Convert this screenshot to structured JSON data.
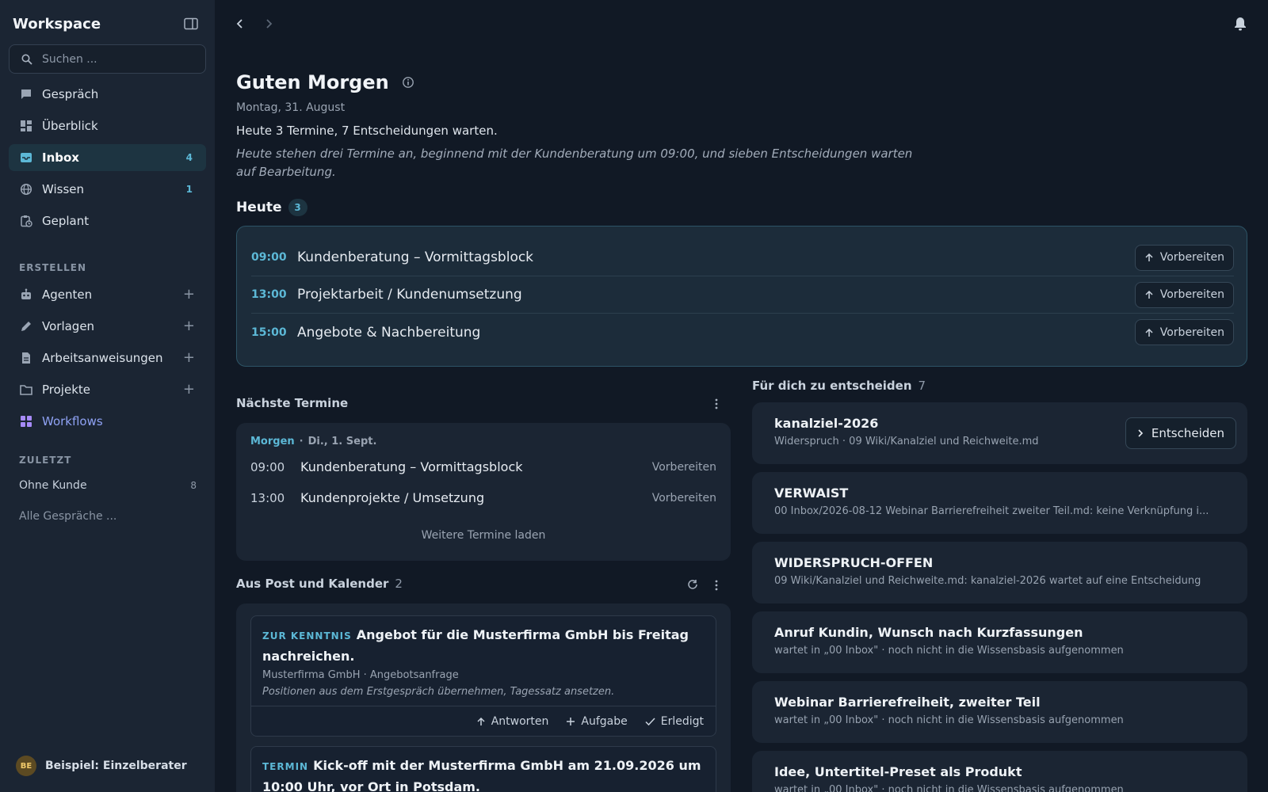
{
  "sidebar": {
    "title": "Workspace",
    "search_placeholder": "Suchen ...",
    "nav": [
      {
        "label": "Gespräch",
        "icon": "chat-icon"
      },
      {
        "label": "Überblick",
        "icon": "dashboard-icon"
      },
      {
        "label": "Inbox",
        "icon": "inbox-icon",
        "badge": "4",
        "active": true
      },
      {
        "label": "Wissen",
        "icon": "globe-icon",
        "badge": "1"
      },
      {
        "label": "Geplant",
        "icon": "clipboard-clock-icon"
      }
    ],
    "create_label": "ERSTELLEN",
    "create": [
      {
        "label": "Agenten",
        "icon": "robot-icon"
      },
      {
        "label": "Vorlagen",
        "icon": "pencil-icon"
      },
      {
        "label": "Arbeitsanweisungen",
        "icon": "document-icon"
      },
      {
        "label": "Projekte",
        "icon": "folder-icon"
      },
      {
        "label": "Workflows",
        "icon": "workflows-icon"
      }
    ],
    "recent_label": "ZULETZT",
    "recent": [
      {
        "label": "Ohne Kunde",
        "count": "8"
      },
      {
        "label": "Alle Gespräche ..."
      }
    ],
    "user": {
      "initials": "BE",
      "name": "Beispiel: Einzelberater"
    }
  },
  "header": {
    "greeting": "Guten Morgen",
    "date": "Montag, 31. August",
    "summary": "Heute 3 Termine, 7 Entscheidungen warten.",
    "summary_long": "Heute stehen drei Termine an, beginnend mit der Kundenberatung um 09:00, und sieben Entscheidungen warten auf Bearbeitung."
  },
  "today": {
    "title": "Heute",
    "count": "3",
    "items": [
      {
        "time": "09:00",
        "title": "Kundenberatung – Vormittagsblock",
        "action": "Vorbereiten"
      },
      {
        "time": "13:00",
        "title": "Projektarbeit / Kundenumsetzung",
        "action": "Vorbereiten"
      },
      {
        "time": "15:00",
        "title": "Angebote & Nachbereitung",
        "action": "Vorbereiten"
      }
    ]
  },
  "next": {
    "title": "Nächste Termine",
    "day_label": "Morgen",
    "day_date": "Di., 1. Sept.",
    "items": [
      {
        "time": "09:00",
        "title": "Kundenberatung – Vormittagsblock",
        "action": "Vorbereiten"
      },
      {
        "time": "13:00",
        "title": "Kundenprojekte / Umsetzung",
        "action": "Vorbereiten"
      }
    ],
    "load_more": "Weitere Termine laden"
  },
  "post": {
    "title": "Aus Post und Kalender",
    "count": "2",
    "items": [
      {
        "tag": "ZUR KENNTNIS",
        "title": "Angebot für die Musterfirma GmbH bis Freitag nachreichen.",
        "meta": "Musterfirma GmbH · Angebotsanfrage",
        "note": "Positionen aus dem Erstgespräch übernehmen, Tagessatz ansetzen.",
        "actions": {
          "reply": "Antworten",
          "task": "Aufgabe",
          "done": "Erledigt"
        }
      },
      {
        "tag": "TERMIN",
        "title": "Kick-off mit der Musterfirma GmbH am 21.09.2026 um 10:00 Uhr, vor Ort in Potsdam."
      }
    ]
  },
  "decisions": {
    "title": "Für dich zu entscheiden",
    "count": "7",
    "decide_label": "Entscheiden",
    "items": [
      {
        "title": "kanalziel-2026",
        "sub": "Widerspruch · 09 Wiki/Kanalziel und Reichweite.md"
      },
      {
        "title": "VERWAIST",
        "sub": "00 Inbox/2026-08-12 Webinar Barrierefreiheit zweiter Teil.md: keine Verknüpfung i..."
      },
      {
        "title": "WIDERSPRUCH-OFFEN",
        "sub": "09 Wiki/Kanalziel und Reichweite.md: kanalziel-2026 wartet auf eine Entscheidung"
      },
      {
        "title": "Anruf Kundin, Wunsch nach Kurzfassungen",
        "sub": "wartet in „00 Inbox\" · noch nicht in die Wissensbasis aufgenommen"
      },
      {
        "title": "Webinar Barrierefreiheit, zweiter Teil",
        "sub": "wartet in „00 Inbox\" · noch nicht in die Wissensbasis aufgenommen"
      },
      {
        "title": "Idee, Untertitel-Preset als Produkt",
        "sub": "wartet in „00 Inbox\" · noch nicht in die Wissensbasis aufgenommen"
      }
    ]
  }
}
